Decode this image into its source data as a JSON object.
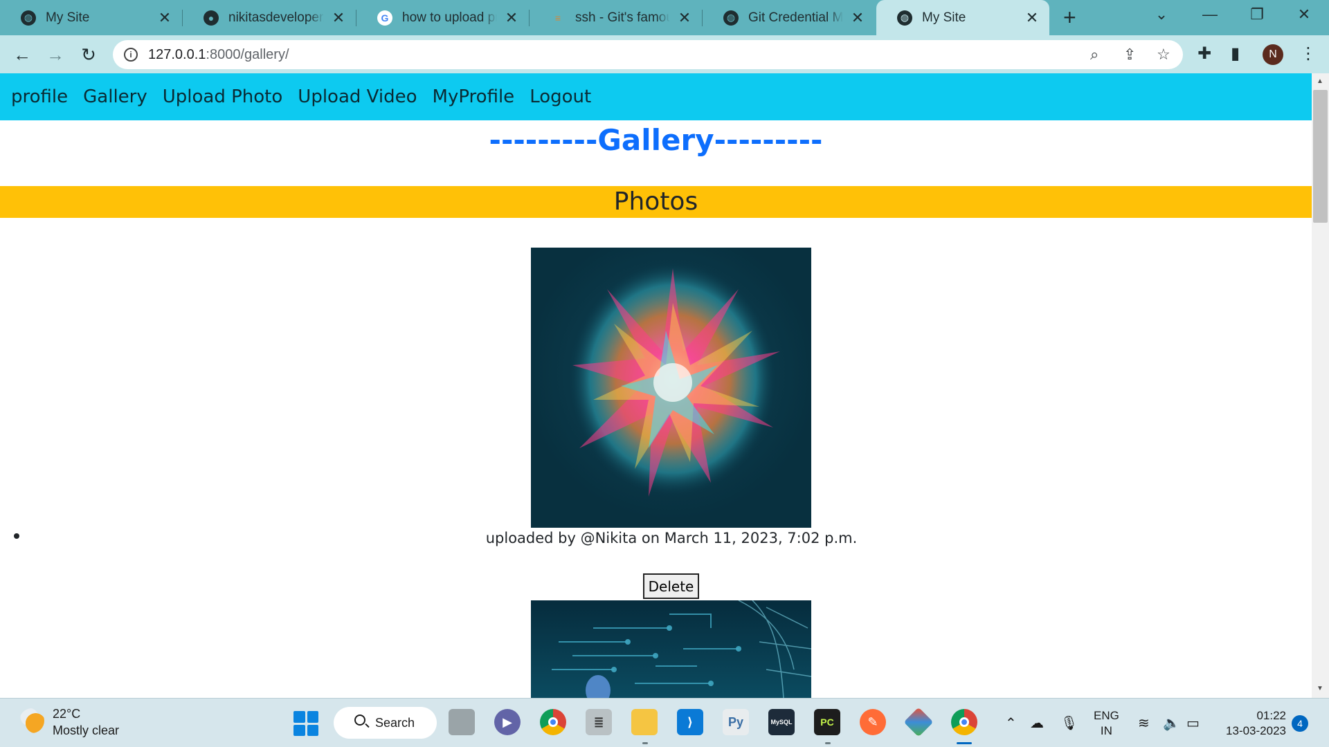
{
  "browser": {
    "tabs": [
      {
        "title": "My Site",
        "icon": "globe-icon"
      },
      {
        "title": "nikitasdeveloper/ga",
        "icon": "github-icon"
      },
      {
        "title": "how to upload proj",
        "icon": "google-icon"
      },
      {
        "title": "ssh - Git's famous \"",
        "icon": "stackoverflow-icon"
      },
      {
        "title": "Git Credential Mana",
        "icon": "globe-icon"
      },
      {
        "title": "My Site",
        "icon": "globe-icon",
        "active": true
      }
    ],
    "url_host": "127.0.0.1",
    "url_rest": ":8000/gallery/",
    "profile_initial": "N"
  },
  "navbar": {
    "links": [
      "profile",
      "Gallery",
      "Upload Photo",
      "Upload Video",
      "MyProfile",
      "Logout"
    ]
  },
  "page": {
    "heading": "---------Gallery---------",
    "section_title": "Photos",
    "items": [
      {
        "caption": "uploaded by @Nikita on March 11, 2023, 7:02 p.m.",
        "delete_label": "Delete"
      }
    ]
  },
  "taskbar": {
    "weather_temp": "22°C",
    "weather_cond": "Mostly clear",
    "search_label": "Search",
    "lang_line1": "ENG",
    "lang_line2": "IN",
    "time": "01:22",
    "date": "13-03-2023",
    "notifications": "4",
    "apps": [
      "task-view",
      "teams",
      "chrome",
      "database",
      "file-explorer",
      "vscode",
      "python",
      "mysql",
      "pycharm",
      "postman",
      "git",
      "chrome-active"
    ]
  },
  "colors": {
    "navbar": "#0dcaf0",
    "heading": "#0d6efd",
    "section_bar": "#ffc107",
    "tabstrip": "#5fb3bd",
    "toolbar": "#c3e6ea"
  }
}
